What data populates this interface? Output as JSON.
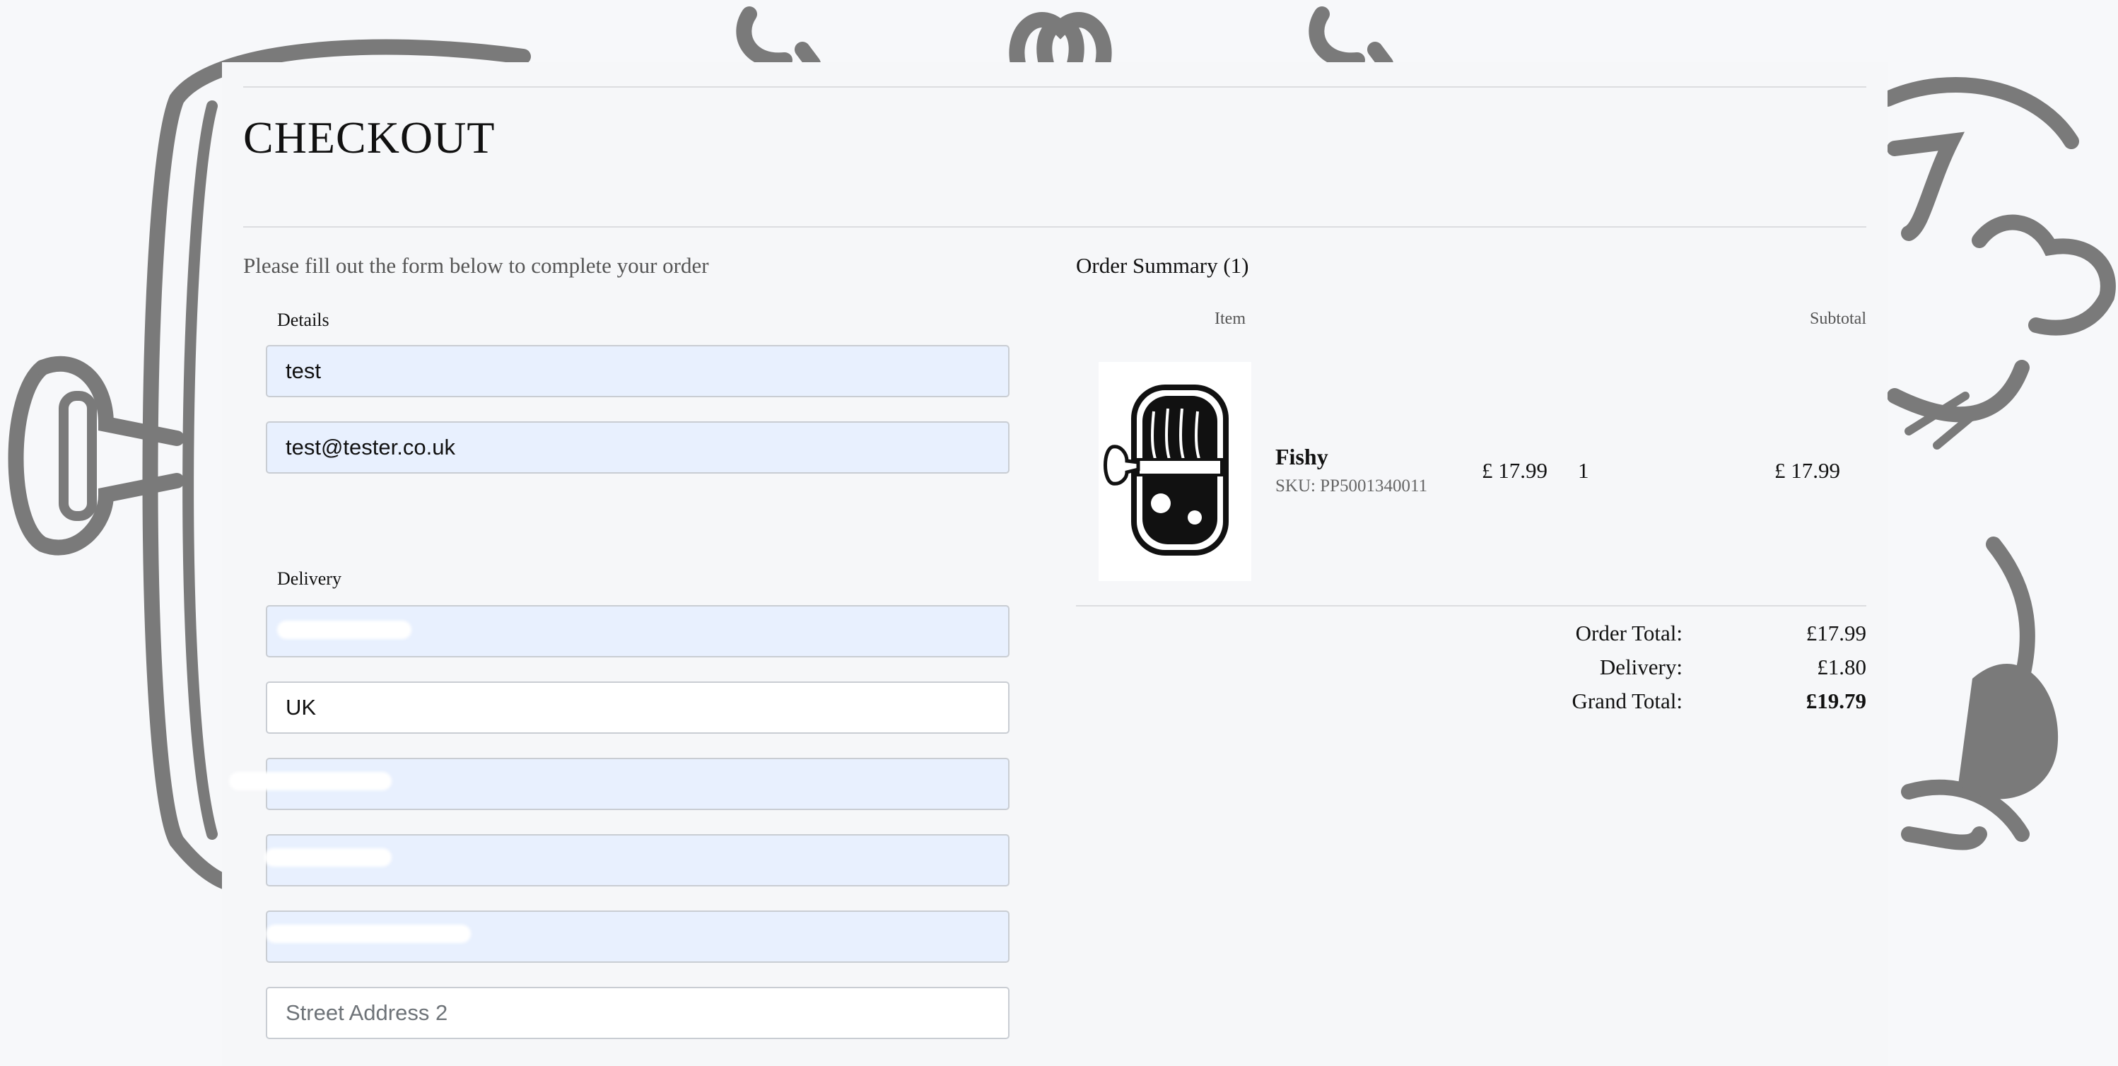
{
  "page": {
    "title": "CHECKOUT",
    "intro": "Please fill out the form below to complete your order"
  },
  "details": {
    "label": "Details",
    "name_value": "test",
    "email_value": "test@tester.co.uk"
  },
  "delivery": {
    "label": "Delivery",
    "address1_value": "",
    "country_value": "UK",
    "city_value": "",
    "county_value": "",
    "postcode_value": "",
    "street2_placeholder": "Street Address 2"
  },
  "summary": {
    "title": "Order Summary (1)",
    "col_item": "Item",
    "col_subtotal": "Subtotal",
    "items": [
      {
        "name": "Fishy",
        "sku": "SKU: PP5001340011",
        "price": "£ 17.99",
        "qty": "1",
        "subtotal": "£ 17.99"
      }
    ],
    "order_total_label": "Order Total:",
    "order_total_value": "£17.99",
    "delivery_label": "Delivery:",
    "delivery_value": "£1.80",
    "grand_total_label": "Grand Total:",
    "grand_total_value": "£19.79"
  },
  "colors": {
    "background": "#f7f8fa",
    "field_autofill": "#e8f0fe",
    "illustration": "#7a7a7a"
  }
}
